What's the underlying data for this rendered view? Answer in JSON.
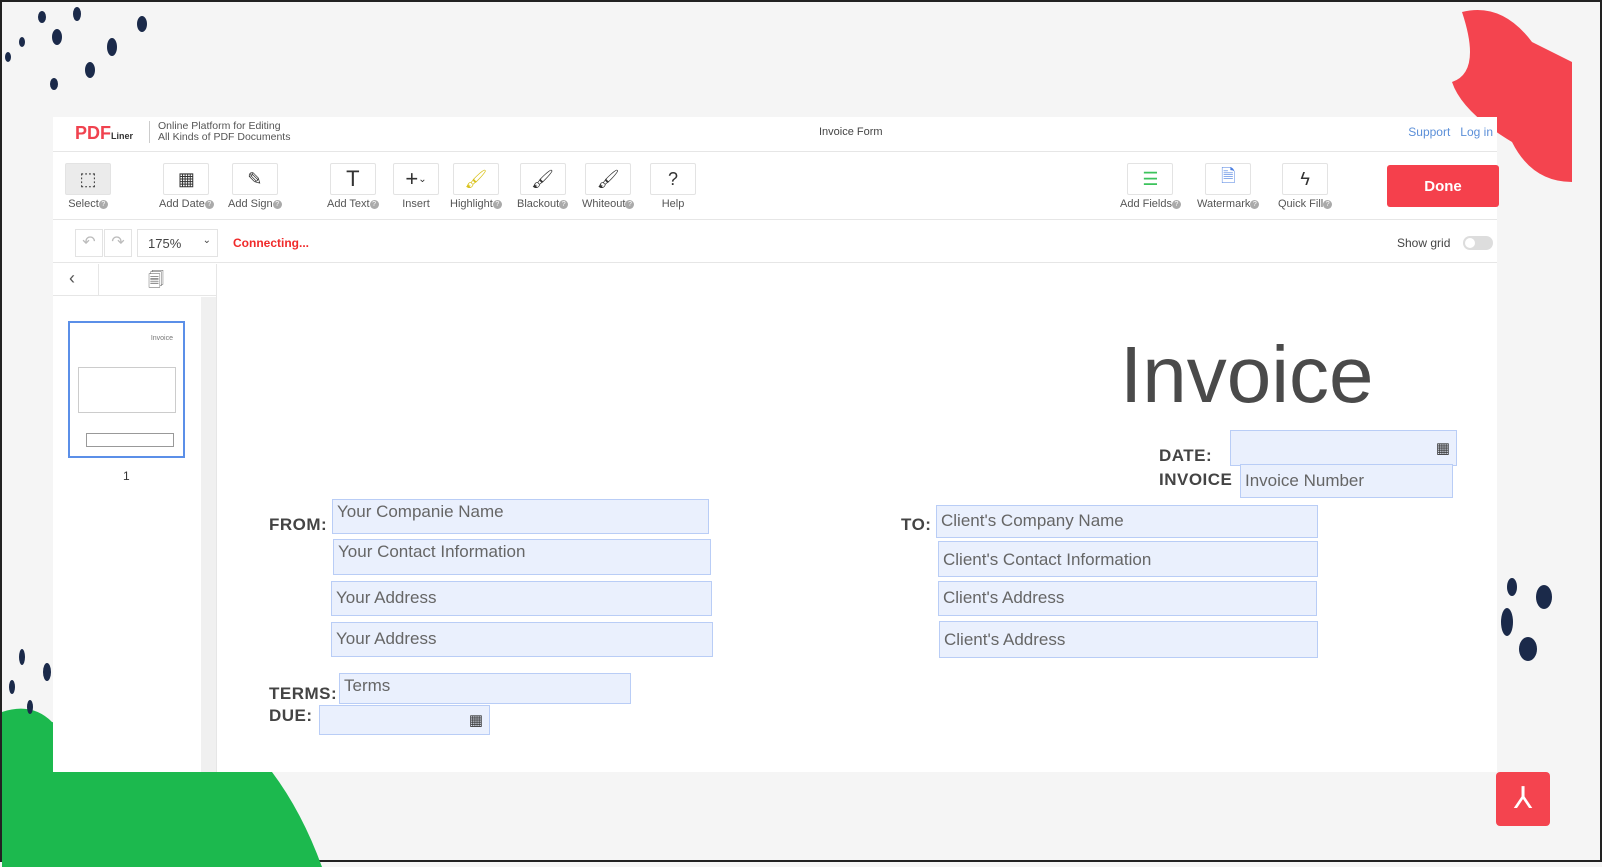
{
  "header": {
    "logo": "PDF",
    "logo_sub": "Liner",
    "tagline_1": "Online Platform for Editing",
    "tagline_2": "All Kinds of PDF Documents",
    "title": "Invoice Form",
    "support": "Support",
    "login": "Log in"
  },
  "toolbar": {
    "tools": [
      {
        "label": "Select",
        "icon": "select-icon"
      },
      {
        "label": "Add Date",
        "icon": "calendar-icon"
      },
      {
        "label": "Add Sign",
        "icon": "pen-icon"
      },
      {
        "label": "Add Text",
        "icon": "text-icon"
      },
      {
        "label": "Insert",
        "icon": "plus-icon"
      },
      {
        "label": "Highlight",
        "icon": "highlight-brush-icon"
      },
      {
        "label": "Blackout",
        "icon": "blackout-brush-icon"
      },
      {
        "label": "Whiteout",
        "icon": "whiteout-brush-icon"
      },
      {
        "label": "Help",
        "icon": "help-icon"
      },
      {
        "label": "Add Fields",
        "icon": "add-fields-icon"
      },
      {
        "label": "Watermark",
        "icon": "watermark-icon"
      },
      {
        "label": "Quick Fill",
        "icon": "lightning-icon"
      }
    ],
    "done": "Done",
    "accent": "#f5404c"
  },
  "subbar": {
    "zoom": "175%",
    "status": "Connecting...",
    "show_grid": "Show grid",
    "grid_on": false
  },
  "sidebar": {
    "page_number": "1"
  },
  "document": {
    "heading": "Invoice",
    "date_label": "DATE:",
    "invoice_label": "INVOICE",
    "invoice_placeholder": "Invoice Number",
    "from_label": "FROM:",
    "to_label": "TO:",
    "terms_label": "TERMS:",
    "due_label": "DUE:",
    "from_fields": [
      "Your Companie Name",
      "Your Contact Information",
      "Your Address",
      "Your Address"
    ],
    "to_fields": [
      "Client's Company Name",
      "Client's Contact Information",
      "Client's Address",
      "Client's Address"
    ],
    "terms_placeholder": "Terms"
  }
}
